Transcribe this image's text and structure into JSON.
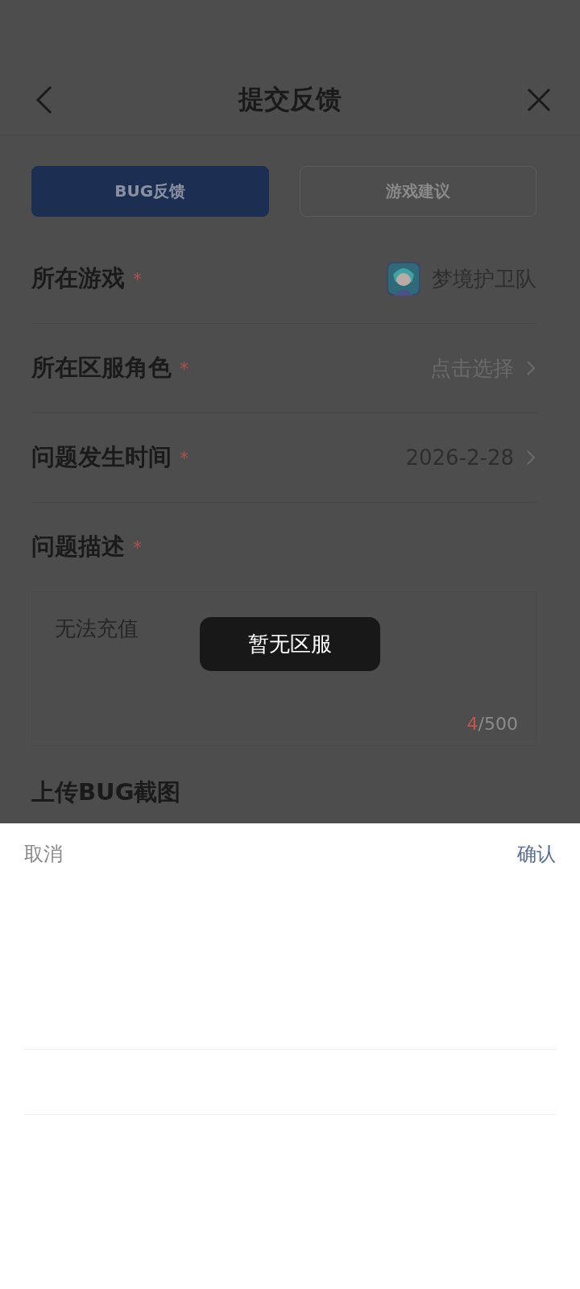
{
  "header": {
    "title": "提交反馈"
  },
  "tabs": [
    {
      "label": "BUG反馈",
      "selected": true
    },
    {
      "label": "游戏建议",
      "selected": false
    }
  ],
  "rows": [
    {
      "label": "所在游戏",
      "mark": "*",
      "kind": "game",
      "value": "梦境护卫队"
    },
    {
      "label": "所在区服角色",
      "mark": "*",
      "kind": "placeholder",
      "value": "点击选择"
    },
    {
      "label": "问题发生时间",
      "mark": "*",
      "kind": "value",
      "value": "2026-2-28"
    }
  ],
  "description": {
    "label": "问题描述",
    "mark": "*",
    "value": "无法充值",
    "count": "4",
    "limit": "/500"
  },
  "upload": {
    "label": "上传BUG截图"
  },
  "toast": "暂无区服",
  "picker": {
    "cancel": "取消",
    "confirm": "确认"
  }
}
